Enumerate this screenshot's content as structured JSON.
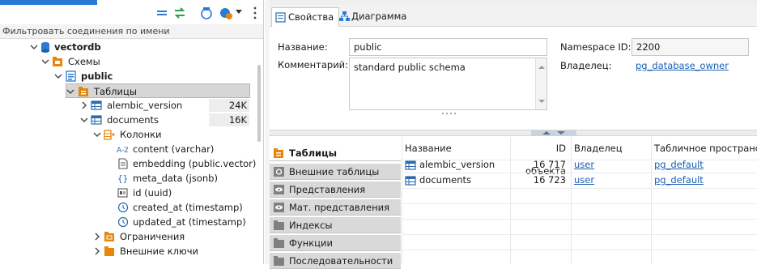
{
  "navigator": {
    "filter_placeholder": "Фильтровать соединения по имени",
    "tree": [
      {
        "id": "vectordb",
        "label": "vectordb",
        "bold": true
      },
      {
        "id": "schemas",
        "label": "Схемы"
      },
      {
        "id": "public",
        "label": "public",
        "bold": true
      },
      {
        "id": "tables",
        "label": "Таблицы",
        "selected": true
      },
      {
        "id": "alembic_version",
        "label": "alembic_version",
        "size": "24K"
      },
      {
        "id": "documents",
        "label": "documents",
        "size": "16K"
      },
      {
        "id": "columns",
        "label": "Колонки"
      },
      {
        "id": "col_content",
        "label": "content (varchar)"
      },
      {
        "id": "col_embedding",
        "label": "embedding (public.vector)"
      },
      {
        "id": "col_meta",
        "label": "meta_data (jsonb)"
      },
      {
        "id": "col_id",
        "label": "id (uuid)"
      },
      {
        "id": "col_created",
        "label": "created_at (timestamp)"
      },
      {
        "id": "col_updated",
        "label": "updated_at (timestamp)"
      },
      {
        "id": "constraints",
        "label": "Ограничения"
      },
      {
        "id": "foreign_keys",
        "label": "Внешние ключи"
      }
    ]
  },
  "editor": {
    "tabs": [
      "Свойства",
      "Диаграмма"
    ],
    "props": {
      "name_label": "Название:",
      "name_value": "public",
      "comment_label": "Комментарий:",
      "comment_value": "standard public schema",
      "ns_label": "Namespace ID:",
      "ns_value": "2200",
      "owner_label": "Владелец:",
      "owner_value": "pg_database_owner"
    },
    "categories": [
      {
        "label": "Таблицы",
        "active": true
      },
      {
        "label": "Внешние таблицы"
      },
      {
        "label": "Представления"
      },
      {
        "label": "Мат. представления"
      },
      {
        "label": "Индексы"
      },
      {
        "label": "Функции"
      },
      {
        "label": "Последовательности"
      }
    ],
    "grid": {
      "headers": [
        "Название",
        "ID объекта",
        "Владелец",
        "Табличное пространство"
      ],
      "rows": [
        [
          "alembic_version",
          "16 717",
          "user",
          "pg_default"
        ],
        [
          "documents",
          "16 723",
          "user",
          "pg_default"
        ]
      ]
    }
  },
  "colors": {
    "accent": "#1a5fb4",
    "folder": "#e8850c",
    "table_icon": "#2a6ab0"
  }
}
